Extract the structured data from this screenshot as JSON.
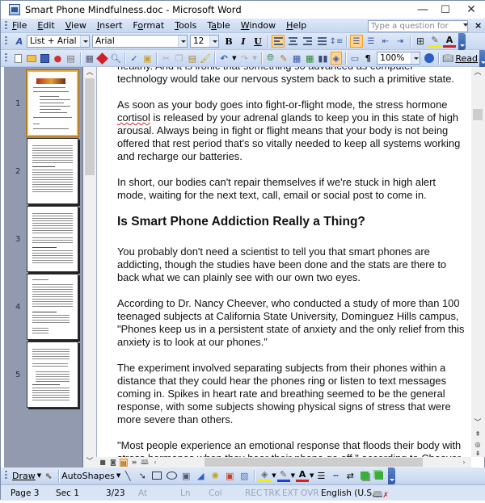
{
  "window": {
    "title": "Smart Phone Mindfulness.doc - Microsoft Word",
    "minimize_label": "—",
    "maximize_label": "☐",
    "close_label": "✕"
  },
  "menubar": {
    "items": [
      {
        "label": "File",
        "key": "F"
      },
      {
        "label": "Edit",
        "key": "E"
      },
      {
        "label": "View",
        "key": "V"
      },
      {
        "label": "Insert",
        "key": "I"
      },
      {
        "label": "Format",
        "key": "o"
      },
      {
        "label": "Tools",
        "key": "T"
      },
      {
        "label": "Table",
        "key": "a"
      },
      {
        "label": "Window",
        "key": "W"
      },
      {
        "label": "Help",
        "key": "H"
      }
    ],
    "help_placeholder": "Type a question for help",
    "help_close": "×"
  },
  "formatting": {
    "style": "List + Arial",
    "font": "Arial",
    "size": "12",
    "bold": "B",
    "italic": "I",
    "underline": "U"
  },
  "standard": {
    "zoom": "100%",
    "read_label": "Read",
    "pilcrow": "¶"
  },
  "thumbnails": {
    "pages": [
      "1",
      "2",
      "3",
      "4",
      "5"
    ],
    "selected_page": "1"
  },
  "document": {
    "paragraphs_top": [
      "healthy. And it is ironic that something so advanced as computer technology would take our nervous system back to such a primitive state.",
      "In short, our bodies can't repair themselves if we're stuck in high alert mode, waiting for the next text, call, email or social post to come in."
    ],
    "p2_before": "As soon as your body goes into fight-or-flight mode, the stress hormone ",
    "p2_misspelled": "cortisol",
    "p2_after": " is released by your adrenal glands to keep you in this state of high arousal. Always being in fight or flight means that your body is not being offered that rest period that's so vitally needed to keep all systems working and recharge our batteries.",
    "heading": "Is Smart Phone Addiction Really a Thing?",
    "paragraphs_bottom": [
      "You probably don't need a scientist to tell you that smart phones are addicting, though the studies have been done and the stats are there to back what we can plainly see with our own two eyes.",
      "According to Dr. Nancy Cheever, who conducted a study of more than 100 teenaged subjects at California State University, Dominguez Hills campus, \"Phones keep us in a persistent state of anxiety and the only relief from this anxiety is to look at our phones.\"",
      "The experiment involved separating subjects from their phones within a distance that they could hear the phones ring or listen to text messages coming in. Spikes in heart rate and breathing seemed to be the general response, with some subjects showing physical signs of stress that were more severe than others.",
      "\"Most people experience an emotional response that floods their body with stress hormones when they hear their phone go off,\" according to Cheever."
    ]
  },
  "drawbar": {
    "draw_label": "Draw",
    "autoshapes_label": "AutoShapes"
  },
  "status": {
    "page": "Page 3",
    "section": "Sec 1",
    "position": "3/23",
    "at": "At",
    "ln": "Ln",
    "col": "Col",
    "rec": "REC",
    "trk": "TRK",
    "ext": "EXT",
    "ovr": "OVR",
    "language": "English (U.S."
  },
  "scroll": {
    "document_vertical_position": 0.14,
    "thumbnail_vertical_position": 0.0,
    "horizontal_position": 0.3
  }
}
